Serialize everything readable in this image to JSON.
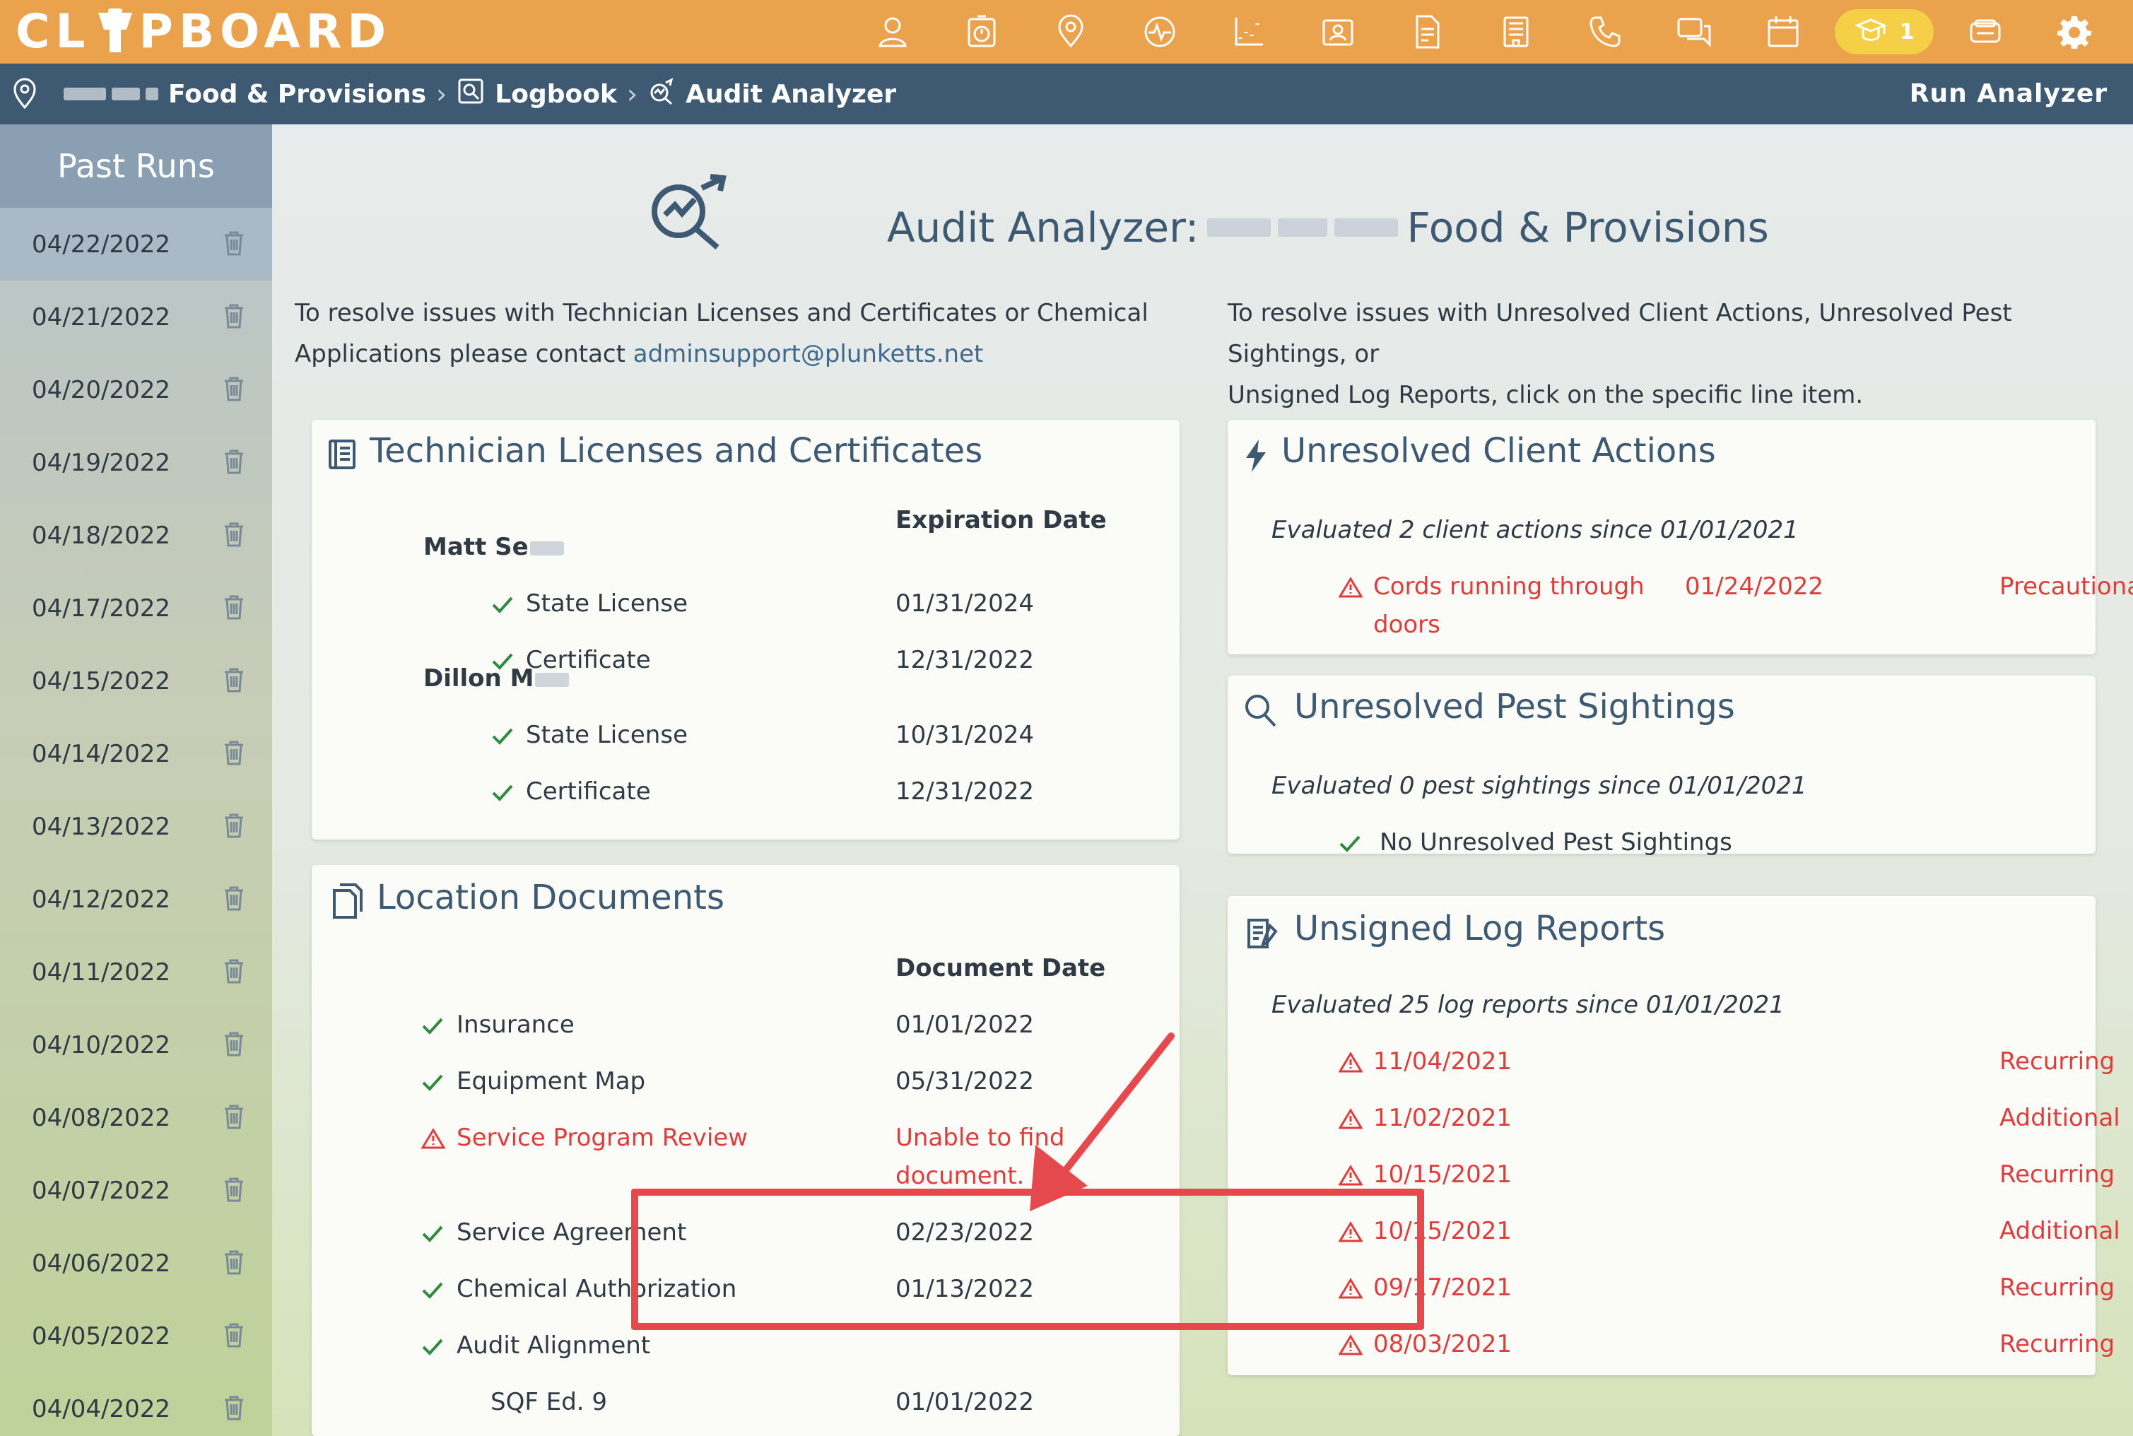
{
  "app": {
    "logo_text_left": "CL",
    "logo_text_right": "PBOARD",
    "top_icons": [
      "user-icon",
      "timer-icon",
      "location-icon",
      "activity-icon",
      "chart-icon",
      "contacts-icon",
      "document-icon",
      "building-icon",
      "phone-icon",
      "chat-icon",
      "calendar-icon",
      "training-icon",
      "badge-icon",
      "gear-icon"
    ],
    "notification_count": "1",
    "accent": "#eaa24c",
    "nav_bg": "#3d5a72",
    "error_color": "#e03c3c"
  },
  "breadcrumb": {
    "location": "Food & Provisions",
    "logbook": "Logbook",
    "current": "Audit Analyzer",
    "run_button": "Run Analyzer"
  },
  "sidebar": {
    "title": "Past Runs",
    "runs": [
      "04/22/2022",
      "04/21/2022",
      "04/20/2022",
      "04/19/2022",
      "04/18/2022",
      "04/17/2022",
      "04/15/2022",
      "04/14/2022",
      "04/13/2022",
      "04/12/2022",
      "04/11/2022",
      "04/10/2022",
      "04/08/2022",
      "04/07/2022",
      "04/06/2022",
      "04/05/2022",
      "04/04/2022"
    ]
  },
  "header": {
    "title_prefix": "Audit Analyzer:",
    "title_suffix": "Food & Provisions"
  },
  "notes": {
    "left_line1": "To resolve issues with Technician Licenses and Certificates or Chemical",
    "left_line2": "Applications please contact",
    "left_email": "adminsupport@plunketts.net",
    "right_line1": "To resolve issues with Unresolved Client Actions, Unresolved Pest Sightings, or",
    "right_line2": "Unsigned Log Reports, click on the specific line item."
  },
  "licenses": {
    "title": "Technician Licenses and Certificates",
    "col_header": "Expiration Date",
    "technicians": [
      {
        "name": "Matt Se",
        "items": [
          {
            "label": "State License",
            "date": "01/31/2024"
          },
          {
            "label": "Certificate",
            "date": "12/31/2022"
          }
        ]
      },
      {
        "name": "Dillon M",
        "items": [
          {
            "label": "State License",
            "date": "10/31/2024"
          },
          {
            "label": "Certificate",
            "date": "12/31/2022"
          }
        ]
      }
    ]
  },
  "documents": {
    "title": "Location Documents",
    "col_header": "Document Date",
    "items": [
      {
        "label": "Insurance",
        "date": "01/01/2022"
      },
      {
        "label": "Equipment Map",
        "date": "05/31/2022"
      },
      {
        "label": "Service Program Review",
        "date_line1": "Unable to find",
        "date_line2": "document."
      },
      {
        "label": "Service Agreement",
        "date": "02/23/2022"
      },
      {
        "label": "Chemical Authorization",
        "date": "01/13/2022"
      },
      {
        "label": "Audit Alignment",
        "date": ""
      },
      {
        "label": "SQF Ed. 9",
        "date": "01/01/2022"
      }
    ]
  },
  "client_actions": {
    "title": "Unresolved Client Actions",
    "summary": "Evaluated 2 client actions since 01/01/2021",
    "item": {
      "line1": "Cords running through",
      "line2": "doors",
      "date": "01/24/2022",
      "type": "Precautionary"
    }
  },
  "pest_sightings": {
    "title": "Unresolved Pest Sightings",
    "summary": "Evaluated 0 pest sightings since 01/01/2021",
    "none_text": "No Unresolved Pest Sightings"
  },
  "log_reports": {
    "title": "Unsigned Log Reports",
    "summary": "Evaluated 25 log reports since 01/01/2021",
    "items": [
      {
        "date": "11/04/2021",
        "type": "Recurring"
      },
      {
        "date": "11/02/2021",
        "type": "Additional"
      },
      {
        "date": "10/15/2021",
        "type": "Recurring"
      },
      {
        "date": "10/15/2021",
        "type": "Additional"
      },
      {
        "date": "09/17/2021",
        "type": "Recurring"
      },
      {
        "date": "08/03/2021",
        "type": "Recurring"
      }
    ]
  }
}
